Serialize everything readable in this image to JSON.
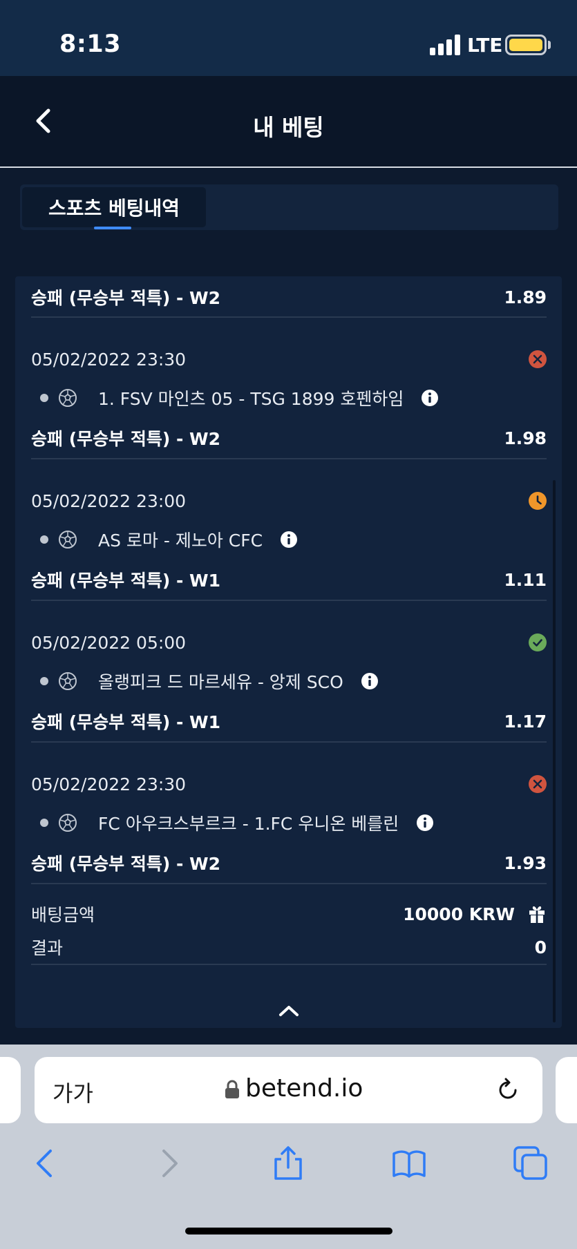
{
  "status_bar": {
    "time": "8:13",
    "network": "LTE"
  },
  "header": {
    "title": "내 베팅"
  },
  "tabs": [
    {
      "label": "스포츠 베팅내역",
      "active": true
    }
  ],
  "bet": {
    "first_selection": {
      "market": "승패 (무승부 적특) - W2",
      "odds": "1.89"
    },
    "selections": [
      {
        "date": "05/02/2022 23:30",
        "status": "lost",
        "match": "1. FSV 마인츠 05 - TSG 1899 호펜하임",
        "market": "승패 (무승부 적특) - W2",
        "odds": "1.98"
      },
      {
        "date": "05/02/2022 23:00",
        "status": "pending",
        "match": "AS 로마 - 제노아 CFC",
        "market": "승패 (무승부 적특) - W1",
        "odds": "1.11"
      },
      {
        "date": "05/02/2022 05:00",
        "status": "won",
        "match": "올랭피크 드 마르세유 - 앙제 SCO",
        "market": "승패 (무승부 적특) - W1",
        "odds": "1.17"
      },
      {
        "date": "05/02/2022 23:30",
        "status": "lost",
        "match": "FC 아우크스부르크 - 1.FC 우니온 베를린",
        "market": "승패 (무승부 적특) - W2",
        "odds": "1.93"
      }
    ],
    "summary": {
      "stake_label": "배팅금액",
      "stake_value": "10000 KRW",
      "result_label": "결과",
      "result_value": "0"
    }
  },
  "browser": {
    "reader_label": "가가",
    "url": "betend.io"
  },
  "colors": {
    "lost": "#d0543f",
    "pending": "#f0962a",
    "won": "#6aaa5a",
    "accent": "#3f8cff"
  }
}
